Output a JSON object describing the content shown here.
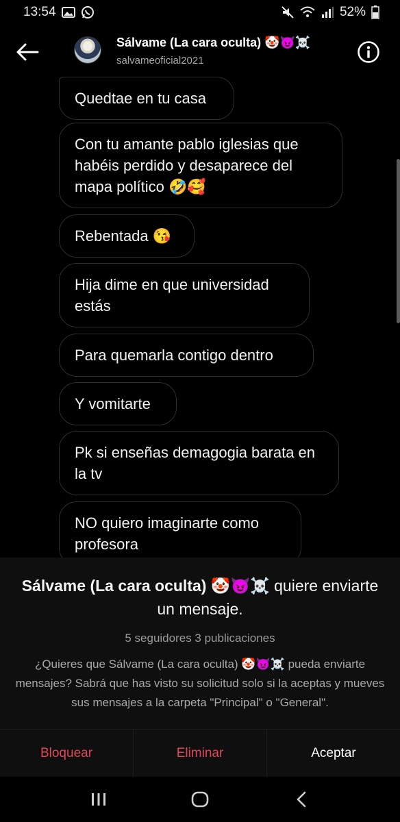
{
  "status_bar": {
    "time": "13:54",
    "battery": "52%",
    "icons": [
      "image-icon",
      "whatsapp-icon",
      "mute-icon",
      "wifi-icon",
      "signal-icon",
      "battery-icon"
    ]
  },
  "header": {
    "title": "Sálvame (La cara oculta) 🤡😈☠️",
    "subtitle": "salvameoficial2021",
    "back_icon": "arrow-left-icon",
    "info_icon": "info-icon"
  },
  "messages": [
    {
      "text": "Quedtae en tu casa"
    },
    {
      "text": "Con tu amante pablo iglesias que habéis perdido y desaparece del mapa político 🤣🥰"
    },
    {
      "text": "Rebentada 😘"
    },
    {
      "text": "Hija dime en que universidad estás"
    },
    {
      "text": "Para quemarla contigo dentro"
    },
    {
      "text": "Y vomitarte"
    },
    {
      "text": "Pk si enseñas demagogia barata en la tv"
    },
    {
      "text": "NO quiero imaginarte como profesora"
    }
  ],
  "request": {
    "sender": "Sálvame (La cara oculta) 🤡😈☠️",
    "title_suffix": " quiere enviarte un mensaje.",
    "meta": "5 seguidores 3 publicaciones",
    "body": "¿Quieres que Sálvame (La cara oculta) 🤡😈☠️ pueda enviarte mensajes? Sabrá que has visto su solicitud solo si la aceptas y mueves sus mensajes a la carpeta \"Principal\" o \"General\"."
  },
  "actions": {
    "block": "Bloquear",
    "delete": "Eliminar",
    "accept": "Aceptar"
  },
  "colors": {
    "danger": "#e0475a",
    "background": "#000000",
    "panel": "#0f0f0f"
  }
}
